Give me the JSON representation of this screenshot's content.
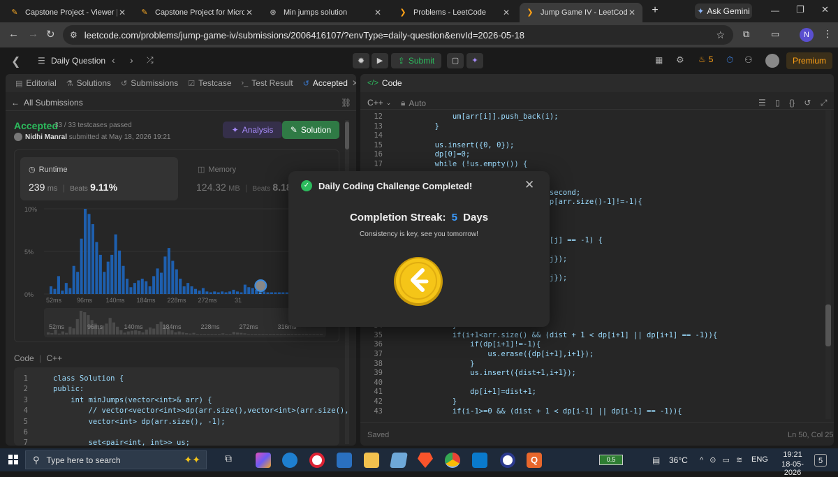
{
  "browser": {
    "tabs": [
      {
        "title": "Capstone Project - Viewer | Lex",
        "icon": "lex-icon"
      },
      {
        "title": "Capstone Project for Microserv",
        "icon": "lex-icon"
      },
      {
        "title": "Min jumps solution",
        "icon": "chatgpt-icon"
      },
      {
        "title": "Problems - LeetCode",
        "icon": "leetcode-icon"
      },
      {
        "title": "Jump Game IV - LeetCode",
        "icon": "leetcode-icon"
      }
    ],
    "ask_gemini": "Ask Gemini",
    "url": "leetcode.com/problems/jump-game-iv/submissions/2006416107/?envType=daily-question&envId=2026-05-18",
    "profile_initial": "N"
  },
  "leetcode": {
    "daily_question": "Daily Question",
    "submit": "Submit",
    "streak_count": "5",
    "premium": "Premium"
  },
  "left_pane": {
    "tabs": [
      "Editorial",
      "Solutions",
      "Submissions",
      "Testcase",
      "Test Result",
      "Accepted"
    ],
    "all_submissions": "All Submissions",
    "status": "Accepted",
    "testcases": "33 / 33 testcases passed",
    "author": "Nidhi Manral",
    "submitted_at": "submitted at May 18, 2026 19:21",
    "analysis_btn": "Analysis",
    "solution_btn": "Solution",
    "runtime_label": "Runtime",
    "runtime_value": "239",
    "runtime_unit": "ms",
    "beats_label": "Beats",
    "runtime_beats": "9.11%",
    "memory_label": "Memory",
    "memory_value": "124.32",
    "memory_unit": "MB",
    "memory_beats": "8.18%",
    "code_label": "Code",
    "code_lang": "C++"
  },
  "chart_data": {
    "type": "bar",
    "yticks": [
      "10%",
      "5%",
      "0%"
    ],
    "xticks": [
      "52ms",
      "96ms",
      "140ms",
      "184ms",
      "228ms",
      "272ms",
      "31"
    ],
    "mini_xticks": [
      "52ms",
      "96ms",
      "140ms",
      "184ms",
      "228ms",
      "272ms",
      "316ms"
    ],
    "ylim": [
      0,
      10
    ],
    "values": [
      0.9,
      0.6,
      2.1,
      0.4,
      1.3,
      0.7,
      3.3,
      2.6,
      6.5,
      10.0,
      9.4,
      8.2,
      6.1,
      4.6,
      2.6,
      3.8,
      4.6,
      7.0,
      5.1,
      3.3,
      1.8,
      0.8,
      1.3,
      1.6,
      1.8,
      1.5,
      0.9,
      2.1,
      3.0,
      2.5,
      4.4,
      5.4,
      3.9,
      2.9,
      1.8,
      0.9,
      1.3,
      0.9,
      0.6,
      0.4,
      0.7,
      0.3,
      0.2,
      0.3,
      0.2,
      0.3,
      0.2,
      0.3,
      0.5,
      0.3,
      0.2,
      1.1,
      0.8,
      0.7,
      0.5,
      0.2,
      0.3,
      0.2,
      0.2,
      0.2,
      0.2,
      0.2,
      0.2,
      0.2,
      0.2,
      0.2,
      0.2,
      0.2,
      0.2,
      0.2,
      0.2,
      0.2,
      0.2,
      0.2,
      0.2,
      0.2
    ],
    "user_index": 55
  },
  "left_code": [
    {
      "n": "1",
      "t": "class Solution {"
    },
    {
      "n": "2",
      "t": "public:"
    },
    {
      "n": "3",
      "t": "    int minJumps(vector<int>& arr) {"
    },
    {
      "n": "4",
      "t": "        // vector<vector<int>>dp(arr.size(),vector<int>(arr.size(),"
    },
    {
      "n": "5",
      "t": "        vector<int> dp(arr.size(), -1);"
    },
    {
      "n": "6",
      "t": ""
    },
    {
      "n": "7",
      "t": "        set<pair<int, int>> us;"
    }
  ],
  "right_pane": {
    "title": "Code",
    "lang": "C++",
    "auto": "Auto",
    "saved": "Saved",
    "cursor": "Ln 50, Col 25"
  },
  "right_code": [
    {
      "n": "12",
      "t": "            um[arr[i]].push_back(i);"
    },
    {
      "n": "13",
      "t": "        }"
    },
    {
      "n": "14",
      "t": ""
    },
    {
      "n": "15",
      "t": "        us.insert({0, 0});"
    },
    {
      "n": "16",
      "t": "        dp[0]=0;"
    },
    {
      "n": "17",
      "t": "        while (!us.empty()) {"
    },
    {
      "n": "",
      "t": ""
    },
    {
      "n": "",
      "t": ""
    },
    {
      "n": "",
      "t": "                                 .second;"
    },
    {
      "n": "",
      "t": "                                 dp[arr.size()-1]!=-1){"
    },
    {
      "n": "",
      "t": ""
    },
    {
      "n": "",
      "t": ""
    },
    {
      "n": "",
      "t": ""
    },
    {
      "n": "",
      "t": "                                dp[j] == -1) {"
    },
    {
      "n": "",
      "t": ""
    },
    {
      "n": "",
      "t": "                                  j});"
    },
    {
      "n": "",
      "t": ""
    },
    {
      "n": "",
      "t": "                                  j});"
    },
    {
      "n": "",
      "t": ""
    },
    {
      "n": "",
      "t": ""
    },
    {
      "n": "",
      "t": ""
    },
    {
      "n": "",
      "t": ""
    },
    {
      "n": "34",
      "t": "            }"
    },
    {
      "n": "35",
      "t": "            if(i+1<arr.size() && (dist + 1 < dp[i+1] || dp[i+1] == -1)){"
    },
    {
      "n": "36",
      "t": "                if(dp[i+1]!=-1){"
    },
    {
      "n": "37",
      "t": "                    us.erase({dp[i+1],i+1});"
    },
    {
      "n": "38",
      "t": "                }"
    },
    {
      "n": "39",
      "t": "                us.insert({dist+1,i+1});"
    },
    {
      "n": "40",
      "t": ""
    },
    {
      "n": "41",
      "t": "                dp[i+1]=dist+1;"
    },
    {
      "n": "42",
      "t": "            }"
    },
    {
      "n": "43",
      "t": "            if(i-1>=0 && (dist + 1 < dp[i-1] || dp[i-1] == -1)){"
    }
  ],
  "modal": {
    "title": "Daily Coding Challenge Completed!",
    "streak_label": "Completion Streak:",
    "streak_value": "5",
    "streak_unit": "Days",
    "subtitle": "Consistency is key, see you tomorrow!"
  },
  "taskbar": {
    "search_placeholder": "Type here to search",
    "battery": "0.5",
    "temperature": "36°C",
    "lang": "ENG",
    "time": "19:21",
    "date": "18-05-2026",
    "notifications": "5"
  },
  "colors": {
    "accent_green": "#2cbb5d",
    "accent_blue": "#3a7bd5",
    "leetcode_orange": "#ffa116",
    "coin_yellow": "#f5c518"
  }
}
